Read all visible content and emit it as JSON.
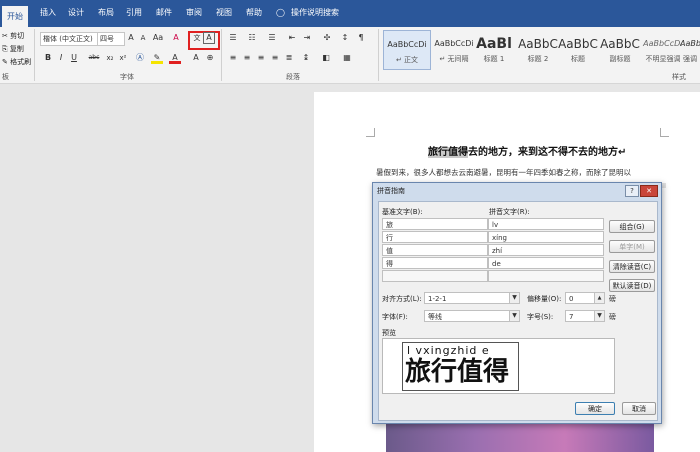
{
  "tabs": [
    "开始",
    "插入",
    "设计",
    "布局",
    "引用",
    "邮件",
    "审阅",
    "视图",
    "帮助"
  ],
  "tell_me": "操作说明搜索",
  "clipboard": {
    "cut": "剪切",
    "copy": "复制",
    "format_painter": "格式刷",
    "label": "板"
  },
  "font_group": {
    "font_name": "楷体 (中文正文)",
    "font_size": "四号",
    "label": "字体",
    "bold": "B",
    "italic": "I",
    "underline": "U",
    "strike": "abc",
    "subscript": "x₂",
    "superscript": "x²",
    "aa": "Aa",
    "grow": "A",
    "shrink": "A",
    "clear": "A",
    "phonetic": "文",
    "enclosed": "A"
  },
  "paragraph_group": {
    "label": "段落"
  },
  "styles_group": {
    "label": "样式",
    "items": [
      {
        "preview": "AaBbCcDi",
        "name": "↵ 正文"
      },
      {
        "preview": "AaBbCcDi",
        "name": "↵ 无间隔"
      },
      {
        "preview": "AaBl",
        "name": "标题 1"
      },
      {
        "preview": "AaBbC",
        "name": "标题 2"
      },
      {
        "preview": "AaBbC",
        "name": "标题"
      },
      {
        "preview": "AaBbC",
        "name": "副标题"
      },
      {
        "preview": "AaBbCcD.",
        "name": "不明显强调"
      },
      {
        "preview": "AaBbCcD",
        "name": "强调"
      }
    ]
  },
  "document": {
    "heading_selected": "旅行值得",
    "heading_rest": "去的地方，来到这不得不去的地方↵",
    "body_line": "暑假到来，很多人都想去云南避暑，昆明有一年四季如春之称，而除了昆明以"
  },
  "dialog": {
    "title": "拼音指南",
    "help": "?",
    "close": "✕",
    "base_label": "基准文字(B):",
    "ruby_label": "拼音文字(R):",
    "rows": [
      {
        "base": "旅",
        "ruby": "lv"
      },
      {
        "base": "行",
        "ruby": "xíng"
      },
      {
        "base": "值",
        "ruby": "zhí"
      },
      {
        "base": "得",
        "ruby": "de"
      }
    ],
    "group_btn": "组合(G)",
    "mono_btn": "单字(M)",
    "clear_btn": "清除读音(C)",
    "default_btn": "默认读音(D)",
    "align_label": "对齐方式(L):",
    "align_value": "1-2-1",
    "offset_label": "偏移量(O):",
    "offset_value": "0",
    "offset_unit": "磅",
    "font_label": "字体(F):",
    "font_value": "等线",
    "size_label": "字号(S):",
    "size_value": "7",
    "size_unit": "磅",
    "preview_label": "预览",
    "preview_ruby": "l vxingzhid e",
    "preview_text": "旅行值得",
    "ok": "确定",
    "cancel": "取消"
  }
}
